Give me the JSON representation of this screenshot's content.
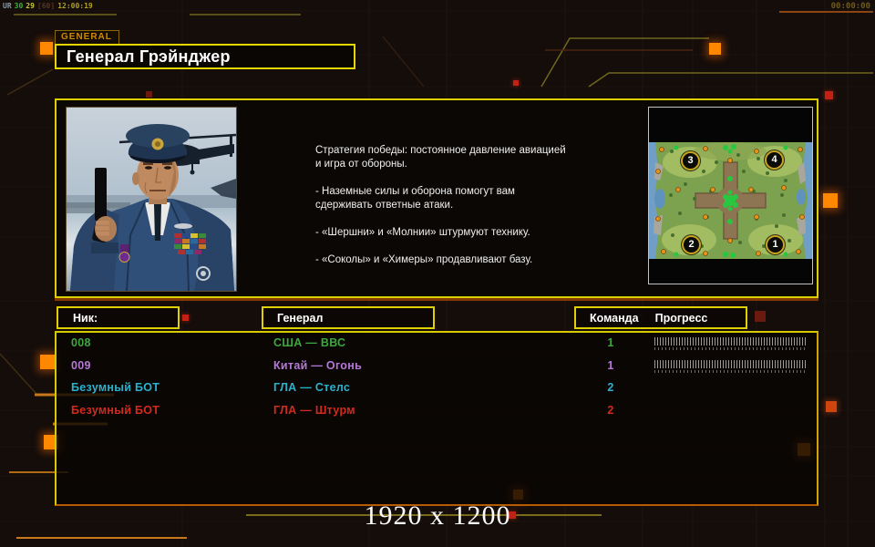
{
  "statusbar": {
    "engine": "UR",
    "fps": "30",
    "value": "29",
    "cap": "[60]",
    "clock": "12:00:19",
    "timer": "00:00:00"
  },
  "tab_label": "GENERAL",
  "title": "Генерал Грэйнджер",
  "briefing": "Стратегия победы: постоянное давление авиацией\n и игра от обороны.\n\n- Наземные силы и оборона помогут вам\n сдерживать ответные атаки.\n\n- «Шершни» и «Молнии» штурмуют технику.\n\n- «Соколы» и «Химеры» продавливают базу.",
  "columns": {
    "nick": "Ник:",
    "general": "Генерал",
    "team": "Команда",
    "progress": "Прогресс"
  },
  "players": [
    {
      "nick": "008",
      "general": "США — ВВС",
      "team": "1",
      "color": "#3da83d",
      "has_progress": true
    },
    {
      "nick": "009",
      "general": "Китай — Огонь",
      "team": "1",
      "color": "#b678d8",
      "has_progress": true
    },
    {
      "nick": "Безумный БОТ",
      "general": "ГЛА — Стелс",
      "team": "2",
      "color": "#29b2cf",
      "has_progress": false
    },
    {
      "nick": "Безумный БОТ",
      "general": "ГЛА — Штурм",
      "team": "2",
      "color": "#d42a1e",
      "has_progress": false
    }
  ],
  "minimap": {
    "spot_tl": "3",
    "spot_tr": "4",
    "spot_bl": "2",
    "spot_br": "1"
  },
  "footer_resolution": "1920 x 1200",
  "colors": {
    "accent_yellow": "#e4d300",
    "accent_orange": "#ff8800",
    "panel_border": "#d8c900"
  }
}
